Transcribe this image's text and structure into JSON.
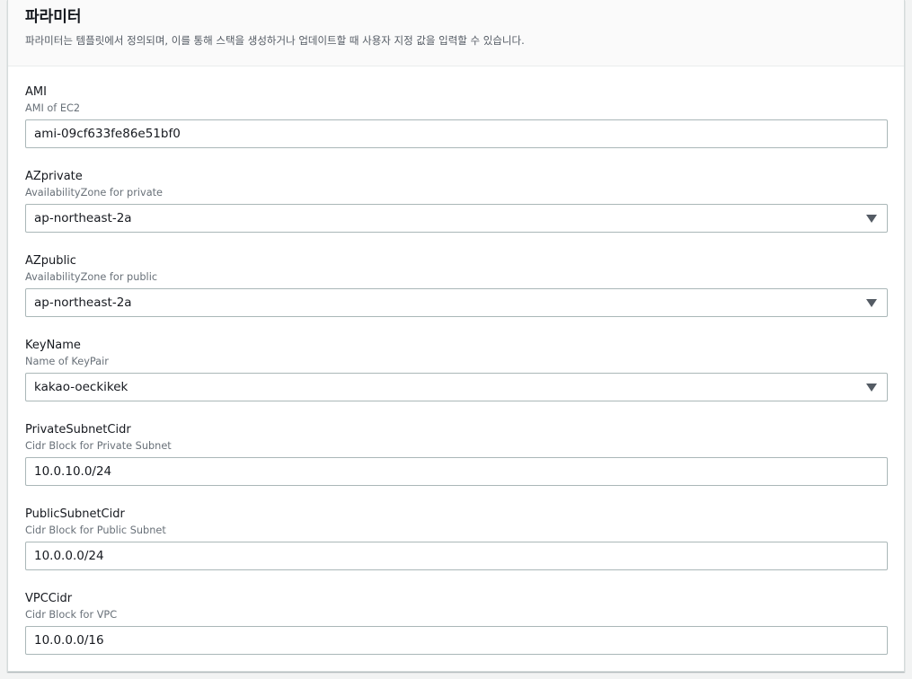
{
  "section": {
    "title": "파라미터",
    "description": "파라미터는 템플릿에서 정의되며, 이를 통해 스택을 생성하거나 업데이트할 때 사용자 지정 값을 입력할 수 있습니다."
  },
  "parameters": [
    {
      "name": "AMI",
      "description": "AMI of EC2",
      "value": "ami-09cf633fe86e51bf0",
      "type": "text",
      "icon": "none"
    },
    {
      "name": "AZprivate",
      "description": "AvailabilityZone for private",
      "value": "ap-northeast-2a",
      "type": "select",
      "icon": "caret-down-icon"
    },
    {
      "name": "AZpublic",
      "description": "AvailabilityZone for public",
      "value": "ap-northeast-2a",
      "type": "select",
      "icon": "caret-down-icon"
    },
    {
      "name": "KeyName",
      "description": "Name of KeyPair",
      "value": "kakao-oeckikek",
      "type": "select",
      "icon": "caret-down-icon"
    },
    {
      "name": "PrivateSubnetCidr",
      "description": "Cidr Block for Private Subnet",
      "value": "10.0.10.0/24",
      "type": "text",
      "icon": "none"
    },
    {
      "name": "PublicSubnetCidr",
      "description": "Cidr Block for Public Subnet",
      "value": "10.0.0.0/24",
      "type": "text",
      "icon": "none"
    },
    {
      "name": "VPCCidr",
      "description": "Cidr Block for VPC",
      "value": "10.0.0.0/16",
      "type": "text",
      "icon": "none"
    }
  ]
}
